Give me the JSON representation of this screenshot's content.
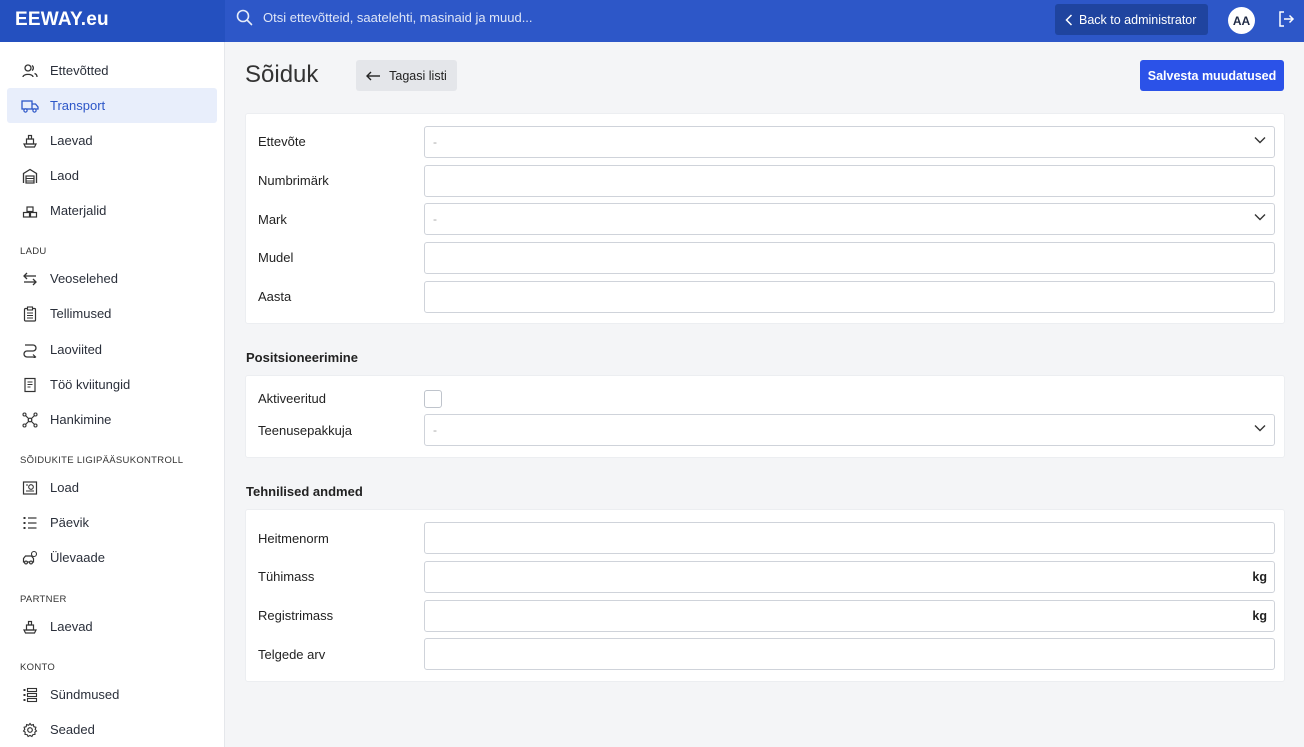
{
  "brand": "EEWAY.eu",
  "search": {
    "placeholder": "Otsi ettevõtteid, saatelehti, masinaid ja muud..."
  },
  "header": {
    "back_admin": "Back to administrator",
    "avatar": "AA"
  },
  "sidebar": {
    "main_items": [
      {
        "label": "Ettevõtted",
        "icon": "users-icon"
      },
      {
        "label": "Transport",
        "icon": "truck-icon",
        "active": true
      },
      {
        "label": "Laevad",
        "icon": "ship-icon"
      },
      {
        "label": "Laod",
        "icon": "warehouse-icon"
      },
      {
        "label": "Materjalid",
        "icon": "materials-icon"
      }
    ],
    "sections": [
      {
        "title": "LADU",
        "items": [
          {
            "label": "Veoselehed",
            "icon": "arrows-swap-icon"
          },
          {
            "label": "Tellimused",
            "icon": "clipboard-icon"
          },
          {
            "label": "Laoviited",
            "icon": "route-icon"
          },
          {
            "label": "Töö kviitungid",
            "icon": "receipt-icon"
          },
          {
            "label": "Hankimine",
            "icon": "network-icon"
          }
        ]
      },
      {
        "title": "SÕIDUKITE LIGIPÄÄSUKONTROLL",
        "items": [
          {
            "label": "Load",
            "icon": "permit-icon"
          },
          {
            "label": "Päevik",
            "icon": "list-icon"
          },
          {
            "label": "Ülevaade",
            "icon": "overview-icon"
          }
        ]
      },
      {
        "title": "PARTNER",
        "items": [
          {
            "label": "Laevad",
            "icon": "ship-icon"
          }
        ]
      },
      {
        "title": "KONTO",
        "items": [
          {
            "label": "Sündmused",
            "icon": "events-icon"
          },
          {
            "label": "Seaded",
            "icon": "gear-icon"
          }
        ]
      }
    ]
  },
  "page": {
    "title": "Sõiduk",
    "back_button": "Tagasi listi",
    "save_button": "Salvesta muudatused"
  },
  "general": {
    "company_label": "Ettevõte",
    "company_value": "-",
    "plate_label": "Numbrimärk",
    "make_label": "Mark",
    "make_value": "-",
    "model_label": "Mudel",
    "year_label": "Aasta"
  },
  "positioning": {
    "title": "Positsioneerimine",
    "activated_label": "Aktiveeritud",
    "provider_label": "Teenusepakkuja",
    "provider_value": "-"
  },
  "technical": {
    "title": "Tehnilised andmed",
    "emission_label": "Heitmenorm",
    "empty_mass_label": "Tühimass",
    "empty_mass_unit": "kg",
    "reg_mass_label": "Registrimass",
    "reg_mass_unit": "kg",
    "axles_label": "Telgede arv"
  }
}
